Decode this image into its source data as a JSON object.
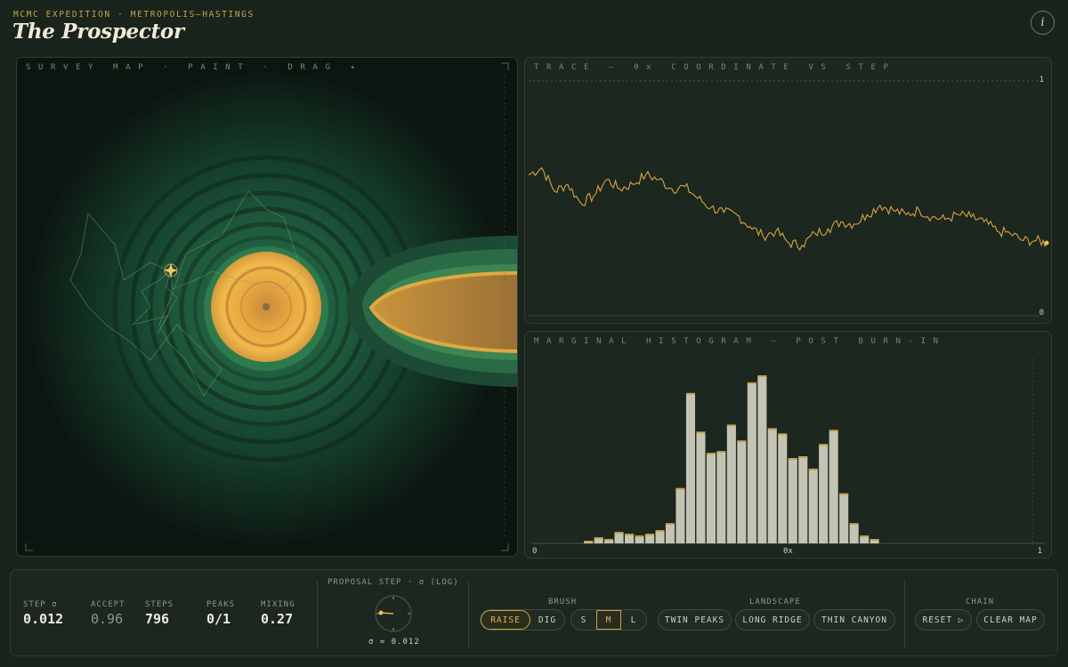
{
  "header": {
    "kicker": "MCMC EXPEDITION · METROPOLIS–HASTINGS",
    "title": "The Prospector",
    "info_icon": "info-icon"
  },
  "survey_map": {
    "label": "SURVEY MAP · PAINT · DRAG ✦"
  },
  "trace": {
    "label": "TRACE — θx COORDINATE VS STEP",
    "y_max_label": "1",
    "y_min_label": "0",
    "color": "#d9a43b"
  },
  "histogram": {
    "label": "MARGINAL HISTOGRAM — POST BURN-IN",
    "x_min_label": "0",
    "x_mid_label": "θx",
    "x_max_label": "1",
    "bar_color": "#c4c4b4",
    "cap_color": "#c9a14a"
  },
  "chart_data": [
    {
      "type": "line",
      "title": "TRACE — θx COORDINATE VS STEP",
      "xlabel": "step",
      "ylabel": "θx",
      "ylim": [
        0,
        1
      ],
      "x": [
        0,
        20,
        40,
        60,
        80,
        100,
        120,
        140,
        160,
        180,
        200,
        220,
        240,
        260,
        280,
        300,
        320,
        340,
        360,
        380,
        400,
        420,
        440,
        460,
        480,
        500,
        520,
        540,
        560,
        580,
        600,
        620,
        640,
        660,
        680,
        700,
        720,
        740,
        760,
        780,
        796
      ],
      "series": [
        {
          "values": [
            0.6,
            0.63,
            0.53,
            0.56,
            0.48,
            0.51,
            0.58,
            0.54,
            0.56,
            0.6,
            0.58,
            0.54,
            0.55,
            0.5,
            0.46,
            0.44,
            0.43,
            0.38,
            0.34,
            0.36,
            0.31,
            0.3,
            0.35,
            0.37,
            0.4,
            0.39,
            0.43,
            0.47,
            0.45,
            0.43,
            0.45,
            0.42,
            0.41,
            0.43,
            0.42,
            0.4,
            0.36,
            0.35,
            0.32,
            0.32,
            0.31
          ]
        }
      ]
    },
    {
      "type": "bar",
      "title": "MARGINAL HISTOGRAM — POST BURN-IN",
      "xlabel": "θx",
      "xlim": [
        0,
        1
      ],
      "x_start": 0.1,
      "bin_width": 0.02,
      "values": [
        1,
        3,
        2,
        6,
        5,
        4,
        5,
        7,
        11,
        31,
        85,
        63,
        51,
        52,
        67,
        58,
        91,
        95,
        65,
        62,
        48,
        49,
        42,
        56,
        64,
        28,
        11,
        4,
        2
      ]
    }
  ],
  "controls": {
    "stats": [
      {
        "label": "STEP σ",
        "value": "0.012"
      },
      {
        "label": "ACCEPT",
        "value": "0.96"
      },
      {
        "label": "STEPS",
        "value": "796"
      },
      {
        "label": "PEAKS",
        "value": "0/1"
      },
      {
        "label": "MIXING",
        "value": "0.27"
      }
    ],
    "proposal": {
      "label": "PROPOSAL STEP · σ (LOG)",
      "readout": "σ = 0.012",
      "dial_level": 0.1
    },
    "brush": {
      "label": "BRUSH",
      "raise": "RAISE",
      "dig": "DIG",
      "size_s": "S",
      "size_m": "M",
      "size_l": "L"
    },
    "landscape": {
      "label": "LANDSCAPE",
      "twin_peaks": "TWIN PEAKS",
      "long_ridge": "LONG RIDGE",
      "thin_canyon": "THIN CANYON"
    },
    "chain": {
      "label": "CHAIN",
      "reset": "RESET ▷",
      "clear_map": "CLEAR MAP"
    }
  }
}
